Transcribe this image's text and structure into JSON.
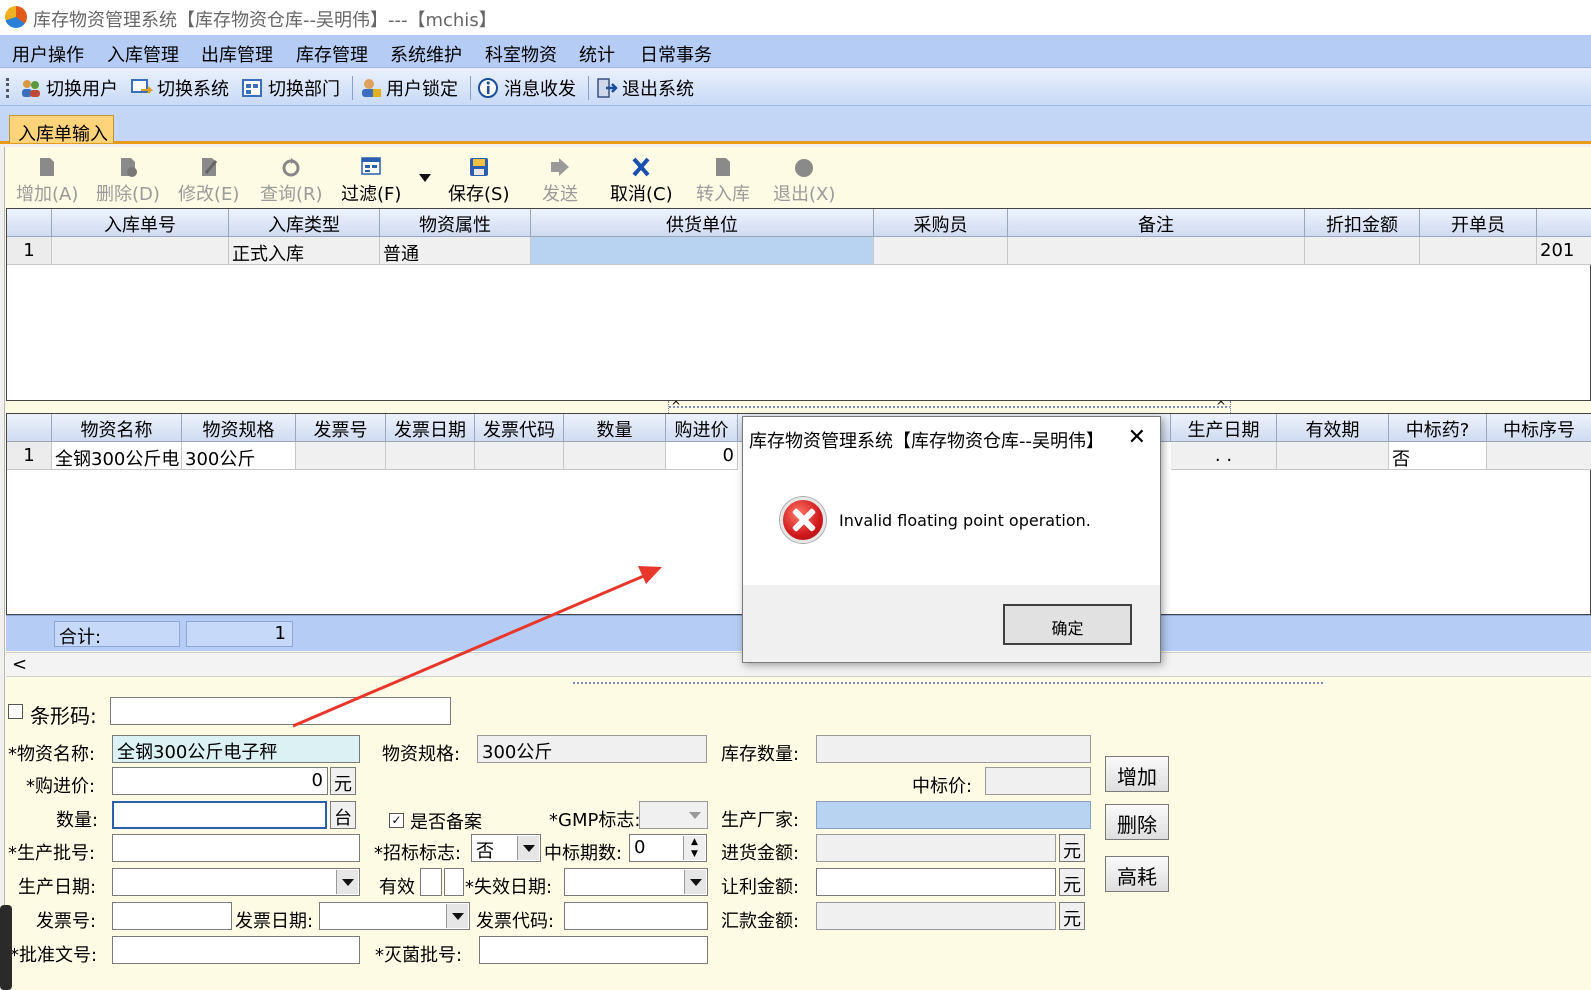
{
  "window": {
    "title": "库存物资管理系统【库存物资仓库--吴明伟】---【mchis】"
  },
  "menu": [
    "用户操作",
    "入库管理",
    "出库管理",
    "库存管理",
    "系统维护",
    "科室物资",
    "统计",
    "日常事务"
  ],
  "toolbar": [
    {
      "label": "切换用户",
      "icon": "users-icon"
    },
    {
      "label": "切换系统",
      "icon": "switch-system-icon"
    },
    {
      "label": "切换部门",
      "icon": "department-icon"
    },
    {
      "label": "用户锁定",
      "icon": "lock-user-icon"
    },
    {
      "label": "消息收发",
      "icon": "info-icon"
    },
    {
      "label": "退出系统",
      "icon": "exit-icon"
    }
  ],
  "tabs": [
    {
      "label": "入库单输入"
    }
  ],
  "actions": [
    {
      "label": "增加(A)",
      "enabled": false
    },
    {
      "label": "删除(D)",
      "enabled": false
    },
    {
      "label": "修改(E)",
      "enabled": false
    },
    {
      "label": "查询(R)",
      "enabled": false
    },
    {
      "label": "过滤(F)",
      "enabled": true
    },
    {
      "label": "保存(S)",
      "enabled": true
    },
    {
      "label": "发送",
      "enabled": false
    },
    {
      "label": "取消(C)",
      "enabled": true
    },
    {
      "label": "转入库",
      "enabled": false
    },
    {
      "label": "退出(X)",
      "enabled": false
    }
  ],
  "grid1": {
    "headers": [
      "入库单号",
      "入库类型",
      "物资属性",
      "供货单位",
      "采购员",
      "备注",
      "折扣金额",
      "开单员"
    ],
    "row": {
      "num": "1",
      "cells": [
        "",
        "正式入库",
        "普通",
        "",
        "",
        "",
        "",
        "",
        "201"
      ]
    }
  },
  "grid2": {
    "headers": [
      "物资名称",
      "物资规格",
      "发票号",
      "发票日期",
      "发票代码",
      "数量",
      "购进价",
      "生产日期",
      "有效期",
      "中标药?",
      "中标序号"
    ],
    "row": {
      "num": "1",
      "cells": [
        "全钢300公斤电",
        "300公斤",
        "",
        "",
        "",
        "",
        "0",
        ". .",
        "",
        "否",
        ""
      ]
    }
  },
  "totals": {
    "label": "合计:",
    "count": "1"
  },
  "form": {
    "barcode_label": "条形码:",
    "name_label": "*物资名称:",
    "name_value": "全钢300公斤电子秤",
    "spec_label": "物资规格:",
    "spec_value": "300公斤",
    "stock_label": "库存数量:",
    "price_label": "*购进价:",
    "price_value": "0",
    "price_unit": "元",
    "bid_price_label": "中标价:",
    "qty_label": "数量:",
    "qty_unit": "台",
    "record_label": "是否备案",
    "gmp_label": "*GMP标志:",
    "manufacturer_label": "生产厂家:",
    "batch_label": "*生产批号:",
    "bid_flag_label": "*招标标志:",
    "bid_flag_value": "否",
    "bid_period_label": "中标期数:",
    "bid_period_value": "0",
    "purchase_amount_label": "进货金额:",
    "purchase_amount_unit": "元",
    "prod_date_label": "生产日期:",
    "valid_label": "有效",
    "expire_label": "*失效日期:",
    "discount_amount_label": "让利金额:",
    "discount_amount_unit": "元",
    "invoice_no_label": "发票号:",
    "invoice_date_label": "发票日期:",
    "invoice_code_label": "发票代码:",
    "remit_amount_label": "汇款金额:",
    "remit_amount_unit": "元",
    "approval_label": "*批准文号:",
    "sterile_label": "*灭菌批号:",
    "btn_add": "增加",
    "btn_delete": "删除",
    "btn_highcost": "高耗"
  },
  "dialog": {
    "title": "库存物资管理系统【库存物资仓库--吴明伟】",
    "message": "Invalid floating point operation.",
    "ok": "确定"
  },
  "colors": {
    "menubar": "#b5cdf5",
    "content": "#fdfbe4",
    "tab_active": "#ffd37a",
    "annotation_arrow": "#e8372a"
  }
}
